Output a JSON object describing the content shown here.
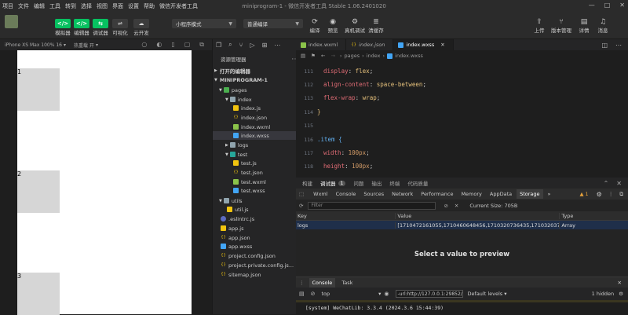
{
  "menubar": {
    "items": [
      "项目",
      "文件",
      "编辑",
      "工具",
      "转到",
      "选择",
      "视图",
      "界面",
      "设置",
      "帮助",
      "微信开发者工具"
    ],
    "title": "miniprogram-1 - 微信开发者工具 Stable 1.06.2401020"
  },
  "toolbar": {
    "simulator": {
      "icon": "</>",
      "label": "模拟器"
    },
    "editor": {
      "icon": "</>",
      "label": "编辑器"
    },
    "debugger": {
      "icon": "⇆",
      "label": "调试器"
    },
    "visual": {
      "icon": "⇌",
      "label": "可视化"
    },
    "cloud": {
      "icon": "☁",
      "label": "云开发"
    },
    "mode_select": "小程序模式",
    "compile_select": "普通编译",
    "compile": "编译",
    "preview": "预览",
    "real_debug": "真机调试",
    "clear_cache": "清缓存",
    "upload": "上传",
    "version": "版本管理",
    "details": "详情",
    "messages": "消息"
  },
  "simulator": {
    "device": "iPhone XS Max 100% 16",
    "hot_reload": "热重载 开",
    "items": [
      "1",
      "2",
      "3"
    ]
  },
  "explorer": {
    "title": "资源管理器",
    "open_editors": "打开的编辑器",
    "project": "MINIPROGRAM-1",
    "tree": [
      {
        "label": "pages",
        "kind": "folder-green"
      },
      {
        "label": "index",
        "kind": "folder"
      },
      {
        "label": "index.js",
        "kind": "js"
      },
      {
        "label": "index.json",
        "kind": "json"
      },
      {
        "label": "index.wxml",
        "kind": "wxml"
      },
      {
        "label": "index.wxss",
        "kind": "wxss"
      },
      {
        "label": "logs",
        "kind": "folder"
      },
      {
        "label": "test",
        "kind": "folder-teal"
      },
      {
        "label": "test.js",
        "kind": "js"
      },
      {
        "label": "test.json",
        "kind": "json"
      },
      {
        "label": "test.wxml",
        "kind": "wxml"
      },
      {
        "label": "test.wxss",
        "kind": "wxss"
      },
      {
        "label": "utils",
        "kind": "folder"
      },
      {
        "label": "util.js",
        "kind": "js"
      },
      {
        "label": ".eslintrc.js",
        "kind": "eslint"
      },
      {
        "label": "app.js",
        "kind": "js"
      },
      {
        "label": "app.json",
        "kind": "json"
      },
      {
        "label": "app.wxss",
        "kind": "wxss"
      },
      {
        "label": "project.config.json",
        "kind": "json"
      },
      {
        "label": "project.private.config.js...",
        "kind": "json"
      },
      {
        "label": "sitemap.json",
        "kind": "json"
      }
    ]
  },
  "editor": {
    "tabs": [
      "index.wxml",
      "index.json",
      "index.wxss"
    ],
    "breadcrumb": [
      "pages",
      "index",
      "index.wxss"
    ],
    "lines": [
      {
        "n": "111",
        "html": "display"
      },
      {
        "n": "112",
        "html": "align"
      },
      {
        "n": "113",
        "html": "wrap"
      },
      {
        "n": "114",
        "html": "close"
      },
      {
        "n": "115",
        "html": ""
      },
      {
        "n": "116",
        "html": "item"
      },
      {
        "n": "117",
        "html": "width"
      },
      {
        "n": "118",
        "html": "height"
      }
    ],
    "code": {
      "l111p": "display",
      "l111v": "flex",
      "l112p": "align-content",
      "l112v": "space-between",
      "l113p": "flex-wrap",
      "l113v": "wrap",
      "l114": "}",
      "l116": ".item {",
      "l117p": "width",
      "l117v": "100px",
      "l118p": "height",
      "l118v": "100px"
    }
  },
  "devtools": {
    "top_tabs": [
      "构建",
      "调试器",
      "1",
      "问题",
      "输出",
      "终端",
      "代码质量"
    ],
    "tabs": [
      "Wxml",
      "Console",
      "Sources",
      "Network",
      "Performance",
      "Memory",
      "AppData",
      "Storage"
    ],
    "warn_count": "1",
    "filter_placeholder": "Filter",
    "current_size": "Current Size: 705B",
    "columns": [
      "Key",
      "Value",
      "Type"
    ],
    "row": {
      "key": "logs",
      "value": "[1710472161055,1710460648456,1710320736435,1710320373416,171...",
      "type": "Array"
    },
    "preview_text": "Select a value to preview"
  },
  "console": {
    "tabs": [
      "Console",
      "Task"
    ],
    "context": "top",
    "url_filter": "-url:http://127.0.0.1:29852/",
    "levels": "Default levels",
    "hidden": "1 hidden",
    "log": "[system] WeChatLib: 3.3.4 (2024.3.6 15:44:39)"
  }
}
